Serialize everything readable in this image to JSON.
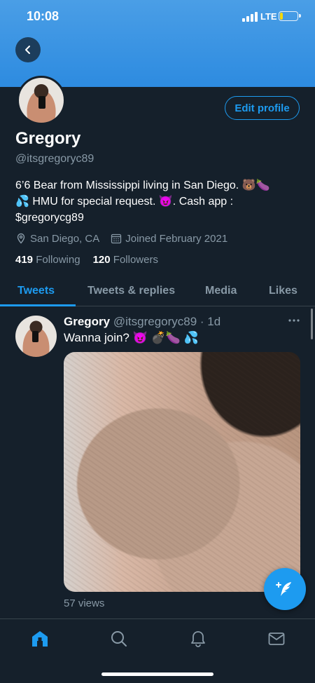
{
  "status_bar": {
    "time": "10:08",
    "network": "LTE",
    "battery_level": 0.2,
    "battery_color": "#f5d90a"
  },
  "colors": {
    "background": "#15202b",
    "accent": "#1d9bf0",
    "secondary_text": "#8899a6",
    "banner": "#4a9ee6"
  },
  "header": {
    "back_icon": "chevron-left-icon"
  },
  "profile": {
    "name": "Gregory",
    "handle": "@itsgregoryc89",
    "edit_profile_label": "Edit profile",
    "bio_line1": "6’6 Bear from Mississippi living in San Diego. 🐻🍆",
    "bio_line2": "💦 HMU for special request. 😈. Cash app :",
    "bio_line3": "$gregorycg89",
    "location": "San Diego, CA",
    "joined": "Joined February 2021",
    "following_count": "419",
    "following_label": "Following",
    "followers_count": "120",
    "followers_label": "Followers"
  },
  "tabs": [
    {
      "label": "Tweets",
      "active": true
    },
    {
      "label": "Tweets & replies",
      "active": false
    },
    {
      "label": "Media",
      "active": false
    },
    {
      "label": "Likes",
      "active": false
    }
  ],
  "tweet": {
    "author_name": "Gregory",
    "author_meta": "@itsgregoryc89 · 1d",
    "text": "Wanna join? 😈 💣🍆 💦",
    "views": "57 views",
    "more_icon": "more-horizontal-icon"
  },
  "fab": {
    "icon": "compose-tweet-icon"
  },
  "bottom_nav": [
    {
      "icon": "home-icon",
      "active": true
    },
    {
      "icon": "search-icon",
      "active": false
    },
    {
      "icon": "notifications-bell-icon",
      "active": false
    },
    {
      "icon": "messages-mail-icon",
      "active": false
    }
  ]
}
